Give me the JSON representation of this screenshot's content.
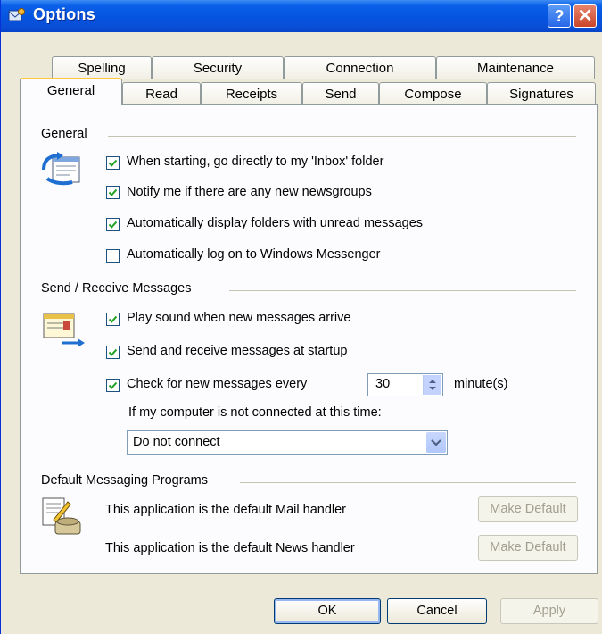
{
  "window": {
    "title": "Options",
    "help_glyph": "?",
    "close_glyph": "✕"
  },
  "tabs": {
    "back_row": [
      "Spelling",
      "Security",
      "Connection",
      "Maintenance"
    ],
    "front_row": [
      "General",
      "Read",
      "Receipts",
      "Send",
      "Compose",
      "Signatures"
    ],
    "active": "General"
  },
  "general": {
    "title": "General",
    "options": [
      {
        "label": "When starting, go directly to my 'Inbox' folder",
        "checked": true
      },
      {
        "label": "Notify me if there are any new newsgroups",
        "checked": true
      },
      {
        "label": "Automatically display folders with unread messages",
        "checked": true
      },
      {
        "label": "Automatically log on to Windows Messenger",
        "checked": false
      }
    ]
  },
  "send_receive": {
    "title": "Send / Receive Messages",
    "play_sound": {
      "label": "Play sound when new messages arrive",
      "checked": true
    },
    "startup": {
      "label": "Send and receive messages at startup",
      "checked": true
    },
    "check_every": {
      "label": "Check for new messages every",
      "checked": true,
      "value": "30",
      "unit": "minute(s)"
    },
    "not_connected_label": "If my computer is not connected at this time:",
    "connect_option": "Do not connect"
  },
  "default_programs": {
    "title": "Default Messaging Programs",
    "mail_text": "This application is the default Mail handler",
    "news_text": "This application is the default News handler",
    "make_default_label": "Make Default"
  },
  "footer": {
    "ok": "OK",
    "cancel": "Cancel",
    "apply": "Apply"
  },
  "colors": {
    "titlebar": "#0554e0",
    "dialog_bg": "#ece9d8",
    "panel_bg": "#fcfcfe",
    "checkmark": "#21a121"
  }
}
